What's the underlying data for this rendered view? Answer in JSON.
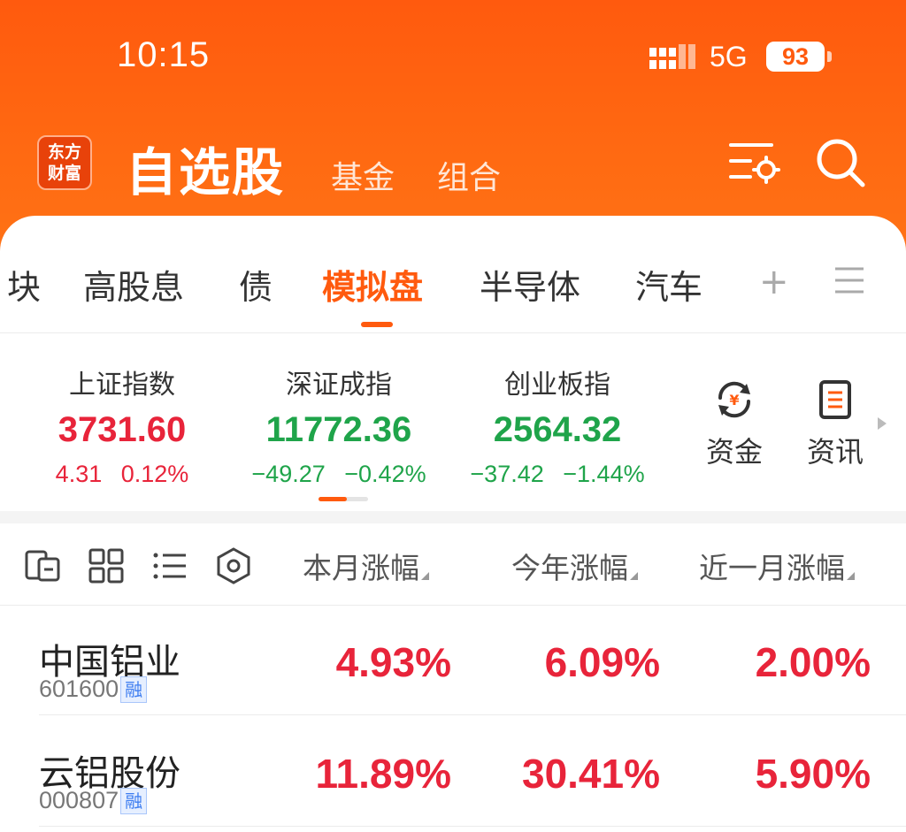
{
  "status_bar": {
    "time": "10:15",
    "network": "5G",
    "battery": "93"
  },
  "nav": {
    "logo_line1": "东方",
    "logo_line2": "财富",
    "title": "自选股",
    "fund": "基金",
    "combo": "组合"
  },
  "tabs": [
    {
      "label": "块"
    },
    {
      "label": "高股息"
    },
    {
      "label": "债"
    },
    {
      "label": "模拟盘",
      "active": true
    },
    {
      "label": "半导体"
    },
    {
      "label": "汽车"
    }
  ],
  "tab_add": "+",
  "indices": [
    {
      "name": "上证指数",
      "value": "3731.60",
      "change": "4.31",
      "percent": "0.12%",
      "dir": "up"
    },
    {
      "name": "深证成指",
      "value": "11772.36",
      "change": "−49.27",
      "percent": "−0.42%",
      "dir": "down"
    },
    {
      "name": "创业板指",
      "value": "2564.32",
      "change": "−37.42",
      "percent": "−1.44%",
      "dir": "down"
    }
  ],
  "quick_actions": {
    "funds": "资金",
    "news": "资讯"
  },
  "table": {
    "columns": [
      "本月涨幅",
      "今年涨幅",
      "近一月涨幅"
    ],
    "tag": "融",
    "rows": [
      {
        "name": "中国铝业",
        "code": "601600",
        "month": "4.93%",
        "year": "6.09%",
        "one_month": "2.00%"
      },
      {
        "name": "云铝股份",
        "code": "000807",
        "month": "11.89%",
        "year": "30.41%",
        "one_month": "5.90%"
      }
    ]
  },
  "colors": {
    "brand": "#ff5a0e",
    "up": "#e8243a",
    "down": "#1fa44a"
  }
}
